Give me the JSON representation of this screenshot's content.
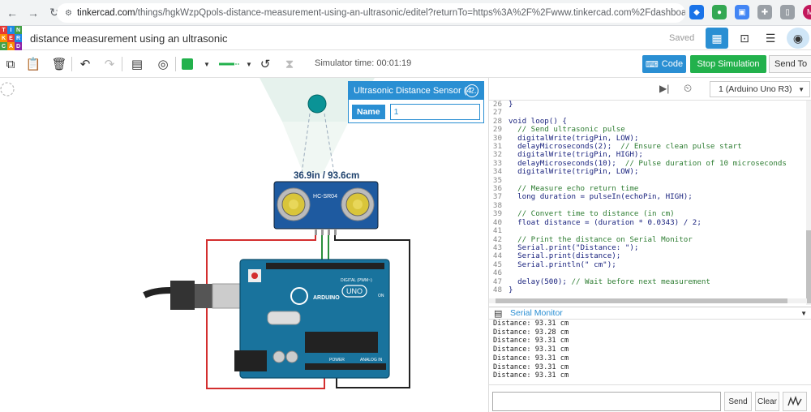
{
  "browser": {
    "url_host": "tinkercad.com",
    "url_rest": "/things/hgkWzpQpols-distance-measurement-using-an-ultrasonic/editel?returnTo=https%3A%2F%2Fwww.tinkercad.com%2Fdashboard%2Fdesigns%2Fcir...",
    "profile_initial": "M"
  },
  "header": {
    "logo_letters": [
      "TIN",
      "KER",
      "CAD"
    ],
    "design_title": "distance measurement using an ultrasonic",
    "saved_label": "Saved"
  },
  "toolbar": {
    "sim_time_label": "Simulator time: 00:01:19",
    "code_label": "Code",
    "stop_label": "Stop Simulation",
    "send_label": "Send To",
    "wire_color": "#22b14c"
  },
  "inspector": {
    "title": "Ultrasonic Distance Sensor (4...",
    "help": "?",
    "name_label": "Name",
    "name_value": "1"
  },
  "canvas": {
    "distance_readout": "36.9in / 93.6cm",
    "sensor_label": "HC-SR04",
    "board_brand": "ARDUINO",
    "board_model": "UNO",
    "digital_label": "DIGITAL (PWM~)",
    "power_label": "POWER",
    "analog_label": "ANALOG IN",
    "on_label": "ON"
  },
  "code_panel": {
    "device_label": "1 (Arduino Uno R3)",
    "lines": [
      {
        "n": "26",
        "t": "}"
      },
      {
        "n": "27",
        "t": ""
      },
      {
        "n": "28",
        "t": "void loop() {"
      },
      {
        "n": "29",
        "t": "  // Send ultrasonic pulse"
      },
      {
        "n": "30",
        "t": "  digitalWrite(trigPin, LOW);"
      },
      {
        "n": "31",
        "t": "  delayMicroseconds(2);  // Ensure clean pulse start"
      },
      {
        "n": "32",
        "t": "  digitalWrite(trigPin, HIGH);"
      },
      {
        "n": "33",
        "t": "  delayMicroseconds(10);  // Pulse duration of 10 microseconds"
      },
      {
        "n": "34",
        "t": "  digitalWrite(trigPin, LOW);"
      },
      {
        "n": "35",
        "t": ""
      },
      {
        "n": "36",
        "t": "  // Measure echo return time"
      },
      {
        "n": "37",
        "t": "  long duration = pulseIn(echoPin, HIGH);"
      },
      {
        "n": "38",
        "t": ""
      },
      {
        "n": "39",
        "t": "  // Convert time to distance (in cm)"
      },
      {
        "n": "40",
        "t": "  float distance = (duration * 0.0343) / 2;"
      },
      {
        "n": "41",
        "t": ""
      },
      {
        "n": "42",
        "t": "  // Print the distance on Serial Monitor"
      },
      {
        "n": "43",
        "t": "  Serial.print(\"Distance: \");"
      },
      {
        "n": "44",
        "t": "  Serial.print(distance);"
      },
      {
        "n": "45",
        "t": "  Serial.println(\" cm\");"
      },
      {
        "n": "46",
        "t": ""
      },
      {
        "n": "47",
        "t": "  delay(500); // Wait before next measurement"
      },
      {
        "n": "48",
        "t": "}"
      }
    ]
  },
  "serial": {
    "title": "Serial Monitor",
    "lines": [
      "Distance: 93.31 cm",
      "Distance: 93.28 cm",
      "Distance: 93.31 cm",
      "Distance: 93.31 cm",
      "Distance: 93.31 cm",
      "Distance: 93.31 cm",
      "Distance: 93.31 cm"
    ],
    "send_label": "Send",
    "clear_label": "Clear"
  }
}
